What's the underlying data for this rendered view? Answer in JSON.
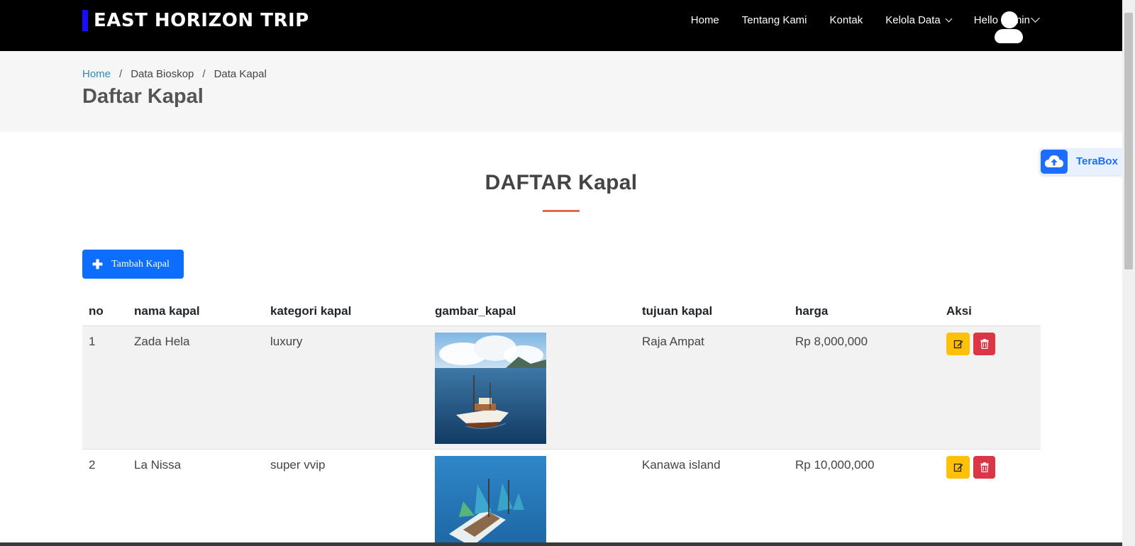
{
  "header": {
    "brand": "EAST HORIZON TRIP",
    "nav": [
      "Home",
      "Tentang Kami",
      "Kontak",
      "Kelola Data",
      "Hello admin"
    ]
  },
  "breadcrumb": {
    "home": "Home",
    "sep": "/",
    "item2": "Data Bioskop",
    "item3": "Data Kapal"
  },
  "page_title": "Daftar Kapal",
  "section_title": "DAFTAR Kapal",
  "add_button": {
    "icon": "plus-icon",
    "label": "Tambah Kapal"
  },
  "table": {
    "headers": [
      "no",
      "nama kapal",
      "kategori kapal",
      "gambar_kapal",
      "tujuan kapal",
      "harga",
      "Aksi"
    ],
    "rows": [
      {
        "no": "1",
        "nama": "Zada Hela",
        "kategori": "luxury",
        "tujuan": "Raja Ampat",
        "harga": "Rp 8,000,000"
      },
      {
        "no": "2",
        "nama": "La Nissa",
        "kategori": "super vvip",
        "tujuan": "Kanawa island",
        "harga": "Rp 10,000,000"
      }
    ]
  },
  "terabox": {
    "label": "TeraBox"
  },
  "colors": {
    "primary": "#0d6efd",
    "warning": "#ffc107",
    "danger": "#dc3545",
    "accent": "#e06a4f",
    "link": "#2b8ab7"
  }
}
